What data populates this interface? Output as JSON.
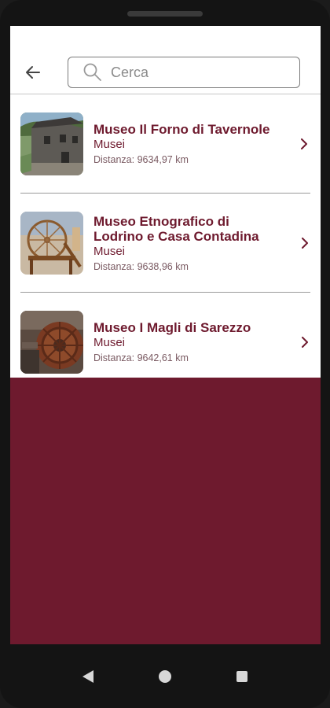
{
  "header": {
    "back_icon": "arrow-left-icon",
    "search": {
      "placeholder": "Cerca",
      "value": ""
    }
  },
  "items": [
    {
      "title": "Museo Il Forno di Tavernole",
      "category": "Musei",
      "distance": "Distanza: 9634,97 km",
      "thumb_icon": "building-photo"
    },
    {
      "title": "Museo Etnografico di Lodrino e Casa Contadina",
      "category": "Musei",
      "distance": "Distanza: 9638,96 km",
      "thumb_icon": "spinning-wheel-photo"
    },
    {
      "title": "Museo I Magli di Sarezzo",
      "category": "Musei",
      "distance": "Distanza: 9642,61 km",
      "thumb_icon": "gear-wheel-photo"
    }
  ],
  "colors": {
    "accent": "#6e1a2e",
    "background": "#ffffff",
    "divider": "#9a9a9a"
  },
  "navbar": {
    "icons": [
      "back-triangle-icon",
      "home-circle-icon",
      "recents-square-icon"
    ]
  }
}
